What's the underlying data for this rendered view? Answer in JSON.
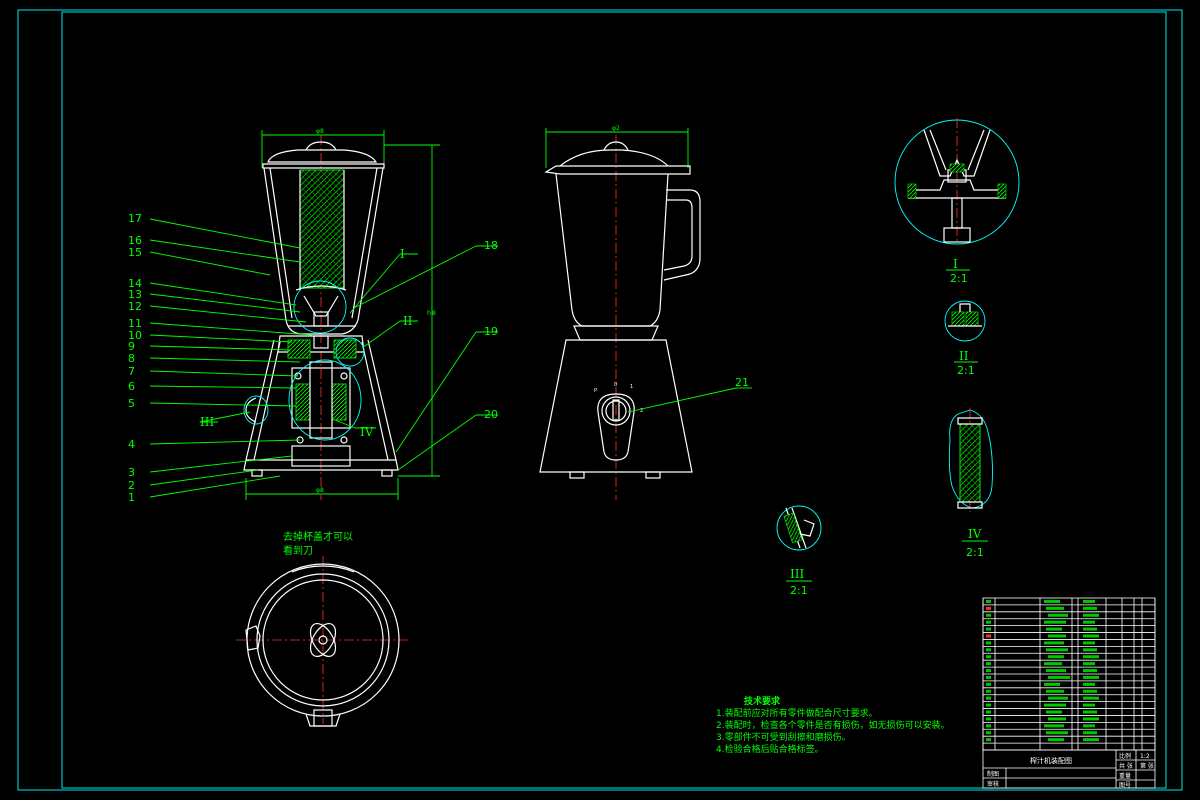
{
  "part_numbers": [
    "1",
    "2",
    "3",
    "4",
    "5",
    "6",
    "7",
    "8",
    "9",
    "10",
    "11",
    "12",
    "13",
    "14",
    "15",
    "16",
    "17",
    "18",
    "19",
    "20",
    "21"
  ],
  "detail_views": {
    "I": {
      "roman": "I",
      "scale": "2:1"
    },
    "II": {
      "roman": "II",
      "scale": "2:1"
    },
    "III": {
      "roman": "III",
      "scale": "2:1"
    },
    "IV": {
      "roman": "IV",
      "scale": "2:1"
    }
  },
  "section_markers": {
    "I": "I",
    "II": "II",
    "III": "III",
    "IV": "IV"
  },
  "dimensions": {
    "front_top_width": "φ8",
    "front_height": "ｈ8",
    "front_base_width": "φ8",
    "side_top_width": "φ2"
  },
  "top_view_note": {
    "line1": "去掉杯盖才可以",
    "line2": "看到刀"
  },
  "tech_requirements": {
    "title": "技术要求",
    "items": [
      "1.装配前应对所有零件做配合尺寸要求。",
      "2.装配时，检查各个零件是否有损伤，如无损伤可以安装。",
      "3.零部件不可受到刮擦和磨损伤。",
      "4.检验合格后贴合格标签。"
    ]
  },
  "title_block": {
    "name": "榨汁机装配图",
    "scale_label": "比例",
    "scale_value": "1:2",
    "sheet_label": "共 张",
    "sheet_value": "第 张",
    "weight_label": "重量",
    "drawing_no_label": "图号",
    "drawn_label": "制图",
    "checked_label": "审核"
  },
  "colors": {
    "background": "#000000",
    "outline": "#ffffff",
    "annotation": "#00ff00",
    "frame": "#00ffff",
    "centerline": "#ff3030"
  }
}
